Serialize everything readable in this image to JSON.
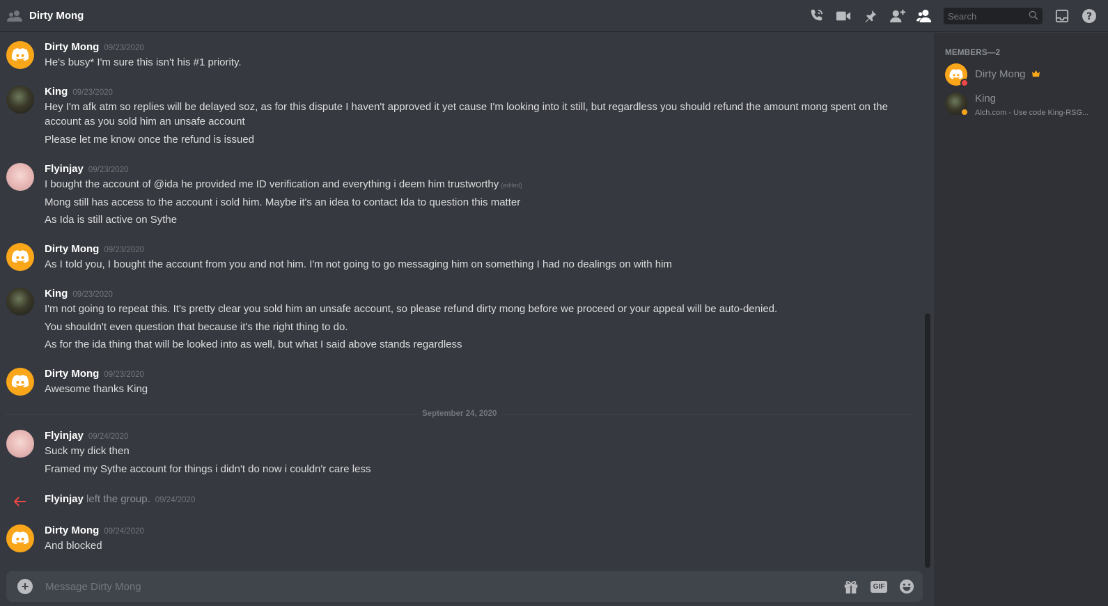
{
  "header": {
    "title": "Dirty Mong",
    "search_placeholder": "Search"
  },
  "toolbar_icons": [
    "call-icon",
    "video-icon",
    "pin-icon",
    "add-friend-icon",
    "members-icon",
    "inbox-icon",
    "help-icon"
  ],
  "messages": [
    {
      "author": "Dirty Mong",
      "timestamp": "09/23/2020",
      "lines": [
        "He's busy* I'm sure this isn't his #1 priority."
      ]
    },
    {
      "author": "King",
      "timestamp": "09/23/2020",
      "lines": [
        "Hey I'm afk atm so replies will be delayed soz, as for this dispute I haven't approved it yet cause I'm looking into it still, but regardless you should refund the amount mong spent on the",
        "account as you sold him an unsafe account",
        "Please let me know once the refund is issued"
      ]
    },
    {
      "author": "Flyinjay",
      "timestamp": "09/23/2020",
      "lines": [
        "I bought the account of @ida he provided me ID verification and everything i deem him trustworthy",
        "Mong still has access to the account i sold him. Maybe it's an idea to contact Ida to question this matter",
        "As Ida is still active on Sythe"
      ],
      "edited": "(edited)"
    },
    {
      "author": "Dirty Mong",
      "timestamp": "09/23/2020",
      "lines": [
        "As I told you, I bought the account from you and not him. I'm not going to go messaging him on something I had no dealings on with him"
      ]
    },
    {
      "author": "King",
      "timestamp": "09/23/2020",
      "lines": [
        "I'm not going to repeat this. It's pretty clear you sold him an unsafe account, so please refund dirty mong before we proceed or your appeal will be auto-denied.",
        "You shouldn't even question that because it's the right thing to do.",
        "As for the ida thing that will be looked into as well, but what I said above stands regardless"
      ]
    },
    {
      "author": "Dirty Mong",
      "timestamp": "09/23/2020",
      "lines": [
        "Awesome thanks King"
      ]
    },
    {
      "author": "Flyinjay",
      "timestamp": "09/24/2020",
      "lines": [
        "Suck my dick then",
        "Framed my Sythe account for things i didn't do now i couldn'r care less"
      ]
    },
    {
      "author": "Dirty Mong",
      "timestamp": "09/24/2020",
      "lines": [
        "And blocked"
      ]
    }
  ],
  "date_divider": "September 24, 2020",
  "system_message": {
    "user": "Flyinjay",
    "text": "left the group.",
    "timestamp": "09/24/2020"
  },
  "composer": {
    "placeholder": "Message Dirty Mong",
    "gif_label": "GIF"
  },
  "members_panel": {
    "title": "MEMBERS—2",
    "members": [
      {
        "name": "Dirty Mong",
        "status": "dnd",
        "status_color": "#f04747",
        "owner_icon": "crown-icon",
        "owner_color": "#faa61a"
      },
      {
        "name": "King",
        "activity": "Alch.com - Use code King-RSG...",
        "status": "idle",
        "status_color": "#faa61a"
      }
    ]
  }
}
